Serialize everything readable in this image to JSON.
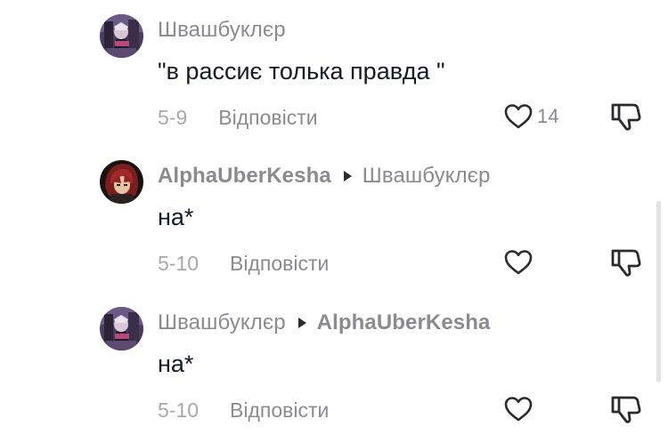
{
  "comments": [
    {
      "author": "Швашбуклєр",
      "reply_to": "",
      "text": "\"в рассиє толька правда \"",
      "date": "5-9",
      "reply_label": "Відповісти",
      "likes": "14",
      "avatar_icon": "avatar-anime-dark"
    },
    {
      "author": "AlphaUberKesha",
      "reply_to": "Швашбуклєр",
      "text": "на*",
      "date": "5-10",
      "reply_label": "Відповісти",
      "likes": "",
      "avatar_icon": "avatar-red-hair"
    },
    {
      "author": "Швашбуклєр",
      "reply_to": "AlphaUberKesha",
      "text": "на*",
      "date": "5-10",
      "reply_label": "Відповісти",
      "likes": "",
      "avatar_icon": "avatar-anime-dark"
    }
  ],
  "colors": {
    "text_primary": "#161823",
    "text_secondary": "#8a8b91",
    "text_date": "#a8a9ad",
    "icon": "#2b2b2f"
  }
}
